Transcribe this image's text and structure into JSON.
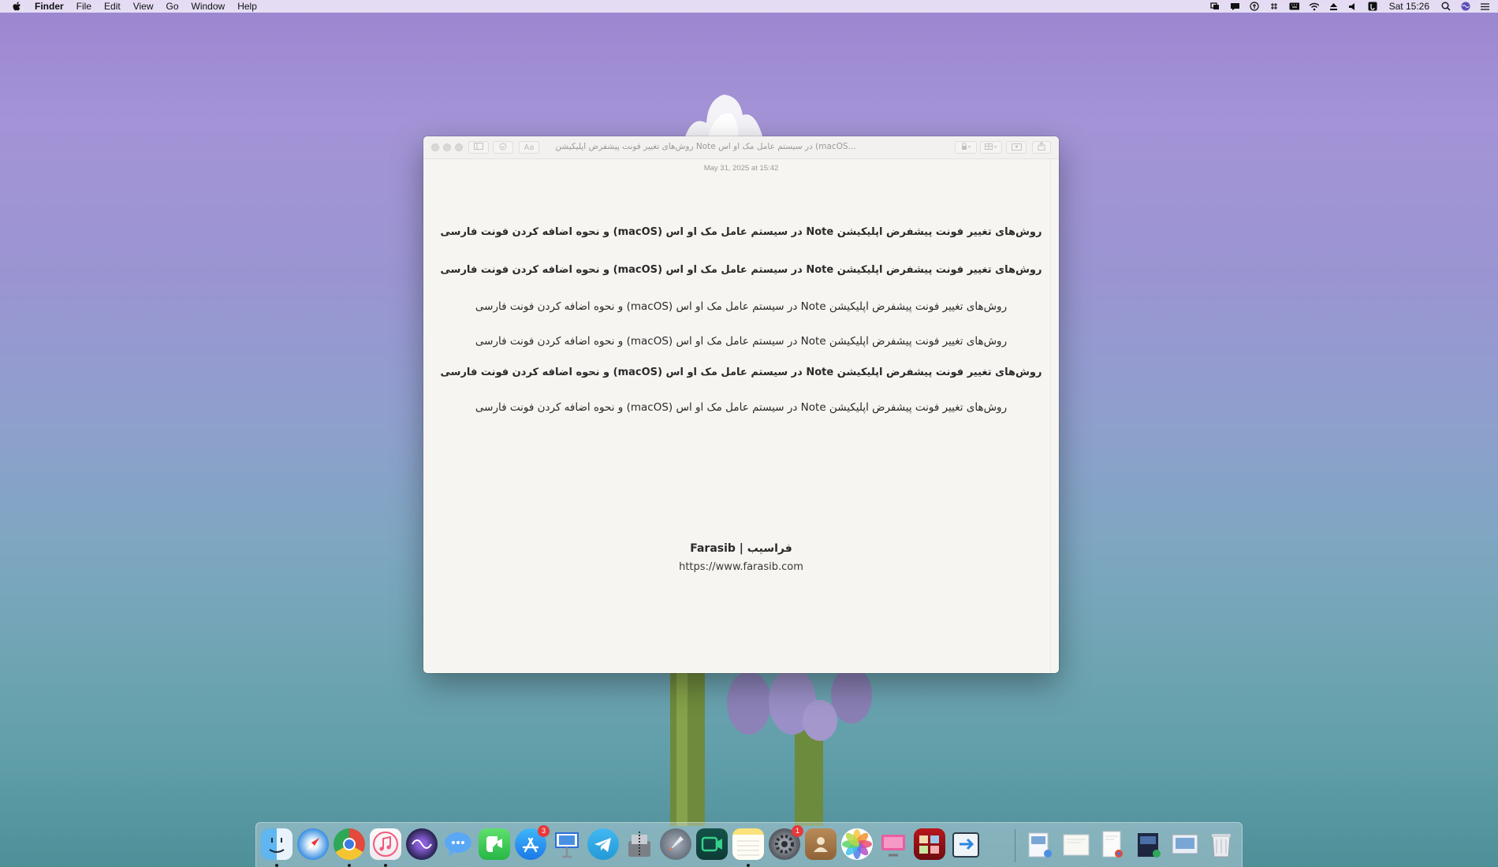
{
  "menubar": {
    "app_name": "Finder",
    "items": [
      "File",
      "Edit",
      "View",
      "Go",
      "Window",
      "Help"
    ],
    "clock": "Sat 15:26"
  },
  "window": {
    "title": "روش‌های تغییر فونت پیشفرض اپلیکیشن Note در سیستم عامل مک او اس (macOS...",
    "format_button": "Aa",
    "date": "May 31, 2025 at 15:42",
    "lines": [
      "روش‌های تغییر فونت پیشفرض اپلیکیشن Note در سیستم عامل مک او اس (macOS) و نحوه اضافه کردن فونت فارسی",
      "روش‌های تغییر فونت پیشفرض اپلیکیشن Note در سیستم عامل مک او اس (macOS) و نحوه اضافه کردن فونت فارسی",
      "روش‌های تغییر فونت پیشفرض اپلیکیشن Note در سیستم عامل مک او اس (macOS) و نحوه اضافه کردن فونت فارسی",
      "روش‌های تغییر فونت پیشفرض اپلیکیشن Note در سیستم عامل مک او اس (macOS) و نحوه اضافه کردن فونت فارسی",
      "روش‌های تغییر فونت پیشفرض اپلیکیشن Note در سیستم عامل مک او اس (macOS) و نحوه اضافه کردن فونت فارسی",
      "روش‌های تغییر فونت پیشفرض اپلیکیشن Note در سیستم عامل مک او اس (macOS) و نحوه اضافه کردن فونت فارسی"
    ],
    "signature": "Farasib | فراسیب",
    "url": "https://www.farasib.com"
  },
  "dock": {
    "app_store_badge": "3",
    "settings_badge": "1",
    "icons": [
      "finder-icon",
      "safari-icon",
      "chrome-icon",
      "music-icon",
      "siri-icon",
      "messages-icon",
      "facetime-icon",
      "app-store-icon",
      "keynote-icon",
      "telegram-icon",
      "archive-utility-icon",
      "launchpad-icon",
      "video-call-icon",
      "notes-icon",
      "system-preferences-icon",
      "contacts-icon",
      "photos-icon",
      "screen-sharing-icon",
      "photo-booth-icon",
      "migration-icon",
      "document-icon",
      "trash-icon"
    ]
  }
}
